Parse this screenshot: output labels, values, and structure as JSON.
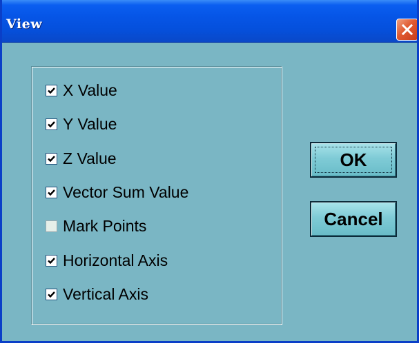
{
  "window": {
    "title": "View",
    "titlebar_color": "#0655e6",
    "background_color": "#7ab6c4",
    "close_icon": "close-icon"
  },
  "options": [
    {
      "label": "X Value",
      "checked": true,
      "enabled": true
    },
    {
      "label": "Y Value",
      "checked": true,
      "enabled": true
    },
    {
      "label": "Z Value",
      "checked": true,
      "enabled": true
    },
    {
      "label": "Vector Sum Value",
      "checked": true,
      "enabled": true
    },
    {
      "label": "Mark Points",
      "checked": false,
      "enabled": false
    },
    {
      "label": "Horizontal Axis",
      "checked": true,
      "enabled": true
    },
    {
      "label": "Vertical Axis",
      "checked": true,
      "enabled": true
    }
  ],
  "buttons": {
    "ok_label": "OK",
    "cancel_label": "Cancel"
  }
}
